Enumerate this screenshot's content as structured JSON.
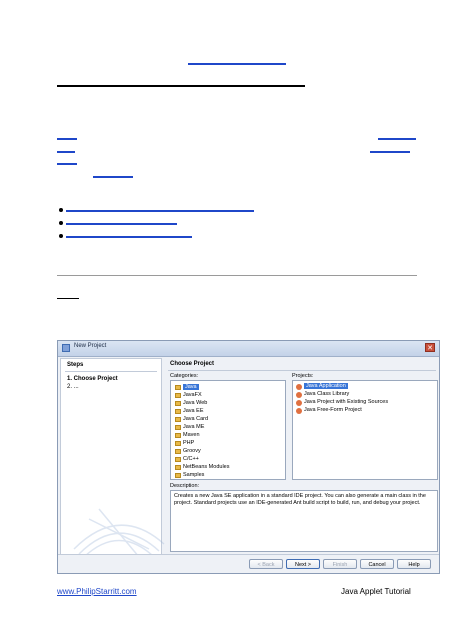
{
  "document": {
    "footer": {
      "left_link": "www.PhilipStarritt.com",
      "right_text": "Java Applet Tutorial"
    }
  },
  "dialog": {
    "title": "New Project",
    "steps": {
      "header": "Steps",
      "items": [
        "1.    Choose Project",
        "2.    ..."
      ]
    },
    "panel_title": "Choose Project",
    "categories_label": "Categories:",
    "categories": [
      "Java",
      "JavaFX",
      "Java Web",
      "Java EE",
      "Java Card",
      "Java ME",
      "Maven",
      "PHP",
      "Groovy",
      "C/C++",
      "NetBeans Modules",
      "Samples"
    ],
    "selected_category": "Java",
    "projects_label": "Projects:",
    "projects": [
      "Java Application",
      "Java Class Library",
      "Java Project with Existing Sources",
      "Java Free-Form Project"
    ],
    "selected_project": "Java Application",
    "description_label": "Description:",
    "description": "Creates a new Java SE application in a standard IDE project. You can also generate a main class in the project. Standard projects use an IDE-generated Ant build script to build, run, and debug your project.",
    "buttons": {
      "back": "< Back",
      "next": "Next >",
      "finish": "Finish",
      "cancel": "Cancel",
      "help": "Help"
    }
  }
}
